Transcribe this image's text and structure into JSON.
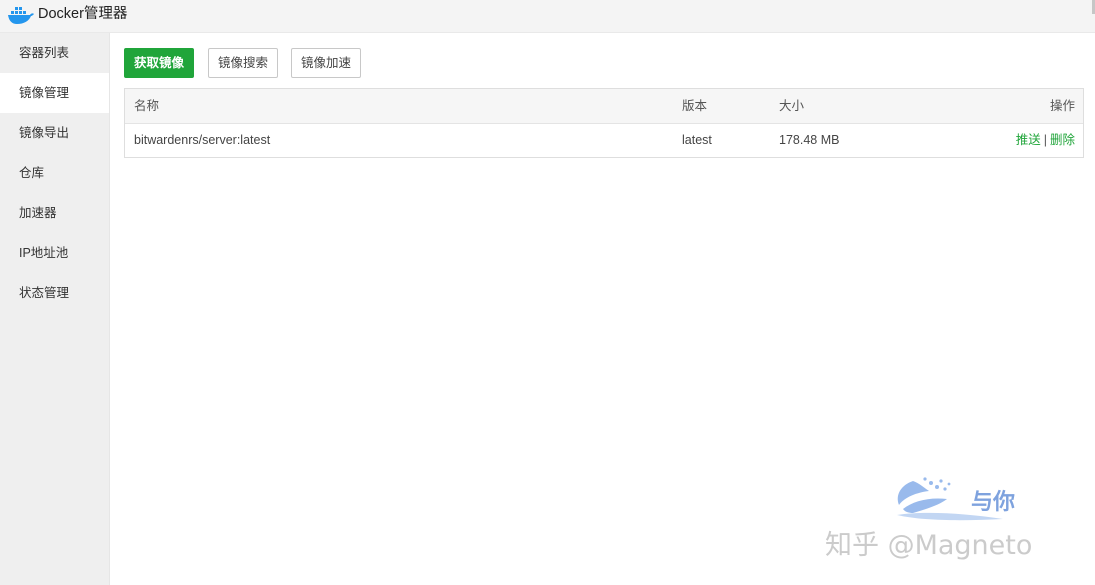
{
  "app": {
    "title": "Docker管理器",
    "logo_icon": "docker-whale-icon"
  },
  "sidebar": {
    "items": [
      {
        "label": "容器列表"
      },
      {
        "label": "镜像管理",
        "active": true
      },
      {
        "label": "镜像导出"
      },
      {
        "label": "仓库"
      },
      {
        "label": "加速器"
      },
      {
        "label": "IP地址池"
      },
      {
        "label": "状态管理"
      }
    ]
  },
  "toolbar": {
    "pull_label": "获取镜像",
    "search_label": "镜像搜索",
    "speed_label": "镜像加速"
  },
  "table": {
    "headers": {
      "name": "名称",
      "version": "版本",
      "size": "大小",
      "ops": "操作"
    },
    "rows": [
      {
        "name": "bitwardenrs/server:latest",
        "version": "latest",
        "size": "178.48 MB",
        "push": "推送",
        "sep": "|",
        "delete": "删除"
      }
    ]
  },
  "watermark": {
    "text": "知乎 @Magneto",
    "logo_text": "与你"
  },
  "colors": {
    "accent": "#20a53a",
    "sidebar_bg": "#efefef",
    "titlebar_bg": "#f4f4f4"
  }
}
